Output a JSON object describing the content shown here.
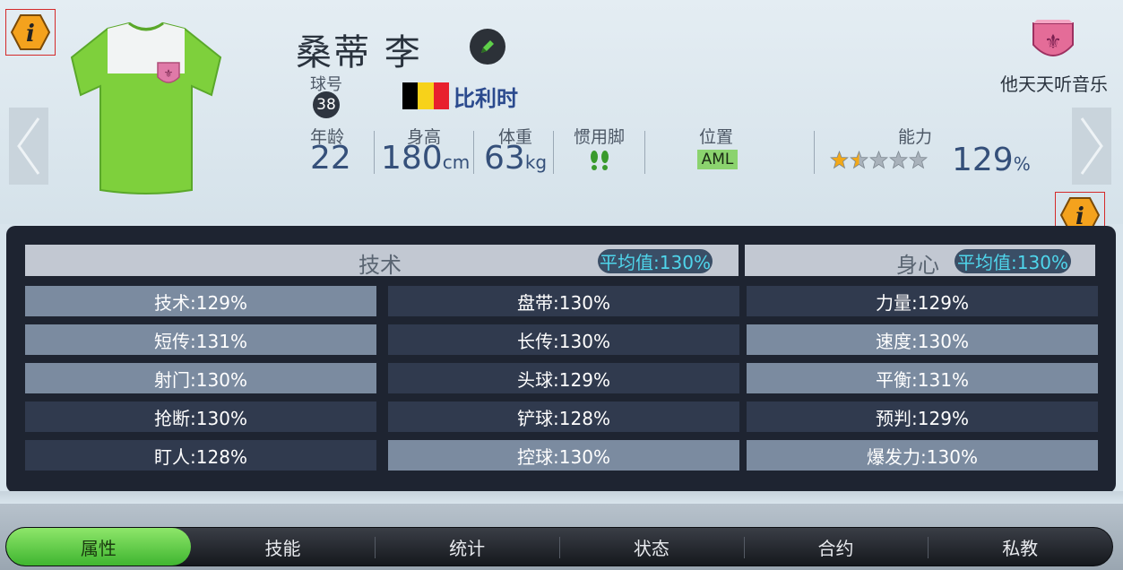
{
  "player": {
    "name": "桑蒂 李",
    "number_label": "球号",
    "number": "38",
    "country": "比利时",
    "flag_colors": [
      "#000000",
      "#f7d21a",
      "#e8212e"
    ],
    "age_label": "年龄",
    "age": "22",
    "height_label": "身高",
    "height": "180",
    "height_unit": "cm",
    "weight_label": "体重",
    "weight": "63",
    "weight_unit": "kg",
    "foot_label": "惯用脚",
    "position_label": "位置",
    "position": "AML",
    "ability_label": "能力",
    "ability": "129",
    "ability_unit": "%",
    "star_rating": 1.5,
    "star_total": 5,
    "jersey_colors": {
      "body": "#7ed03c",
      "chest": "#f2f4f4",
      "accent": "#e07aa8"
    }
  },
  "club": {
    "name": "他天天听音乐",
    "badge_color": "#e46c98"
  },
  "attributes": {
    "technical": {
      "title": "技术",
      "average": "平均值:130%",
      "col1": [
        "技术:129%",
        "短传:131%",
        "射门:130%",
        "抢断:130%",
        "盯人:128%"
      ],
      "col2": [
        "盘带:130%",
        "长传:130%",
        "头球:129%",
        "铲球:128%",
        "控球:130%"
      ]
    },
    "mental": {
      "title": "身心",
      "average": "平均值:130%",
      "col3": [
        "力量:129%",
        "速度:130%",
        "平衡:131%",
        "预判:129%",
        "爆发力:130%"
      ]
    }
  },
  "tabs": [
    "属性",
    "技能",
    "统计",
    "状态",
    "合约",
    "私教"
  ],
  "active_tab": "属性",
  "icons": [
    "info-icon",
    "edit-pencil-icon",
    "left-arrow-icon",
    "right-arrow-icon",
    "footprint-icon",
    "star-icon",
    "club-badge-icon"
  ],
  "colors": {
    "accent_green": "#5fc43a",
    "avg_text": "#4fd6ec",
    "info_orange": "#f4a21d"
  }
}
